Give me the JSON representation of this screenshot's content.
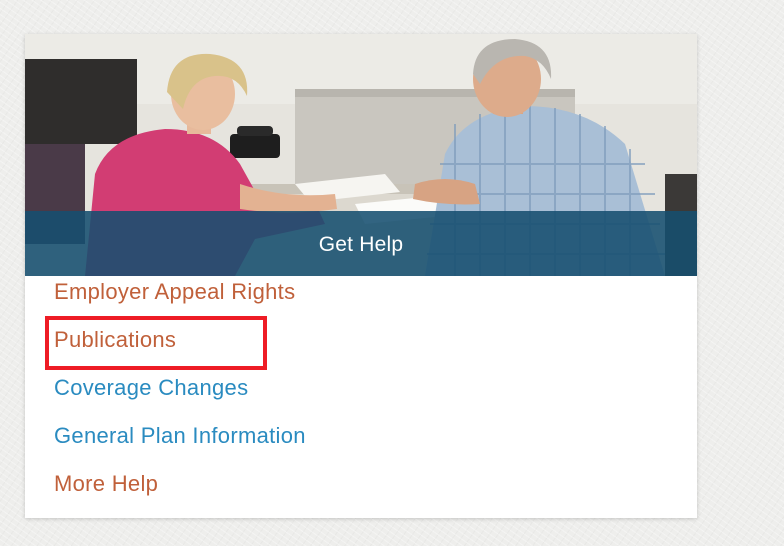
{
  "card": {
    "banner_label": "Get Help",
    "photo_alt": "Two people talking at a desk"
  },
  "links": [
    {
      "label": "Employer Appeal Rights",
      "color": "#c0603a"
    },
    {
      "label": "Publications",
      "color": "#c0603a"
    },
    {
      "label": "Coverage Changes",
      "color": "#2a8bc0"
    },
    {
      "label": "General Plan Information",
      "color": "#2a8bc0"
    },
    {
      "label": "More Help",
      "color": "#c0603a"
    }
  ],
  "colors": {
    "banner": "#164f70",
    "highlight": "#ee1c25",
    "link_orange": "#c0603a",
    "link_blue": "#2a8bc0"
  }
}
